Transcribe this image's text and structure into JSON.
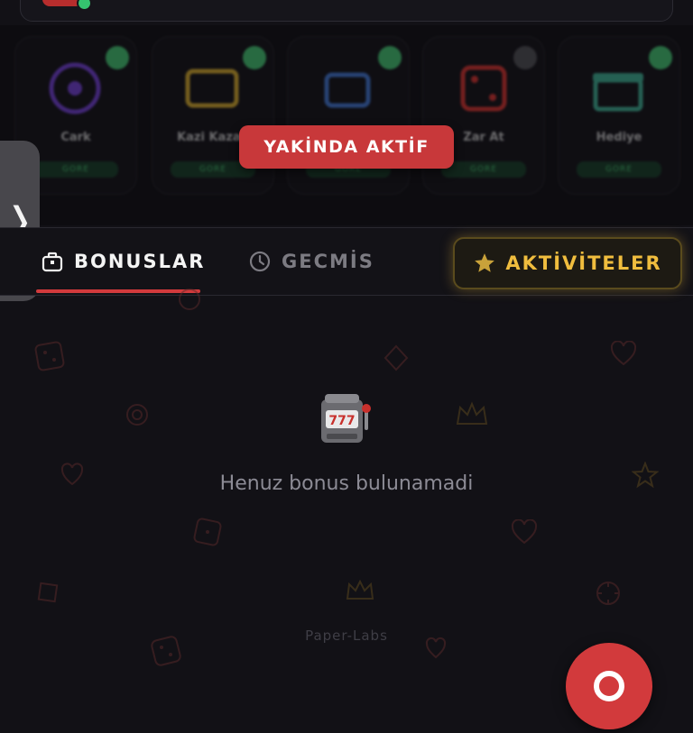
{
  "games_overlay": {
    "label": "YAKİNDA AKTİF",
    "cards": [
      {
        "label": "Cark",
        "button": "GORE"
      },
      {
        "label": "Kazi Kazan",
        "button": "GORE"
      },
      {
        "label": "",
        "button": "GORE"
      },
      {
        "label": "Zar At",
        "button": "GORE"
      },
      {
        "label": "Hediye",
        "button": "GORE"
      }
    ]
  },
  "side_handle": {
    "icon": "chevron-right-icon",
    "glyph": "❭"
  },
  "tabs": {
    "bonuslar": {
      "label": "BONUSLAR",
      "icon": "gift-bag-icon"
    },
    "gecmis": {
      "label": "GECMİS",
      "icon": "clock-icon"
    },
    "aktiviteler": {
      "label": "AKTİVİTELER",
      "icon": "star-icon"
    }
  },
  "empty_state": {
    "icon": "slot-machine-icon",
    "message": "Henuz bonus bulunamadi"
  },
  "footer": {
    "brand": "Paper-Labs"
  },
  "colors": {
    "accent_red": "#d23a3c",
    "gold": "#f0bd3e",
    "background": "#121116",
    "green": "#3fb86a"
  }
}
